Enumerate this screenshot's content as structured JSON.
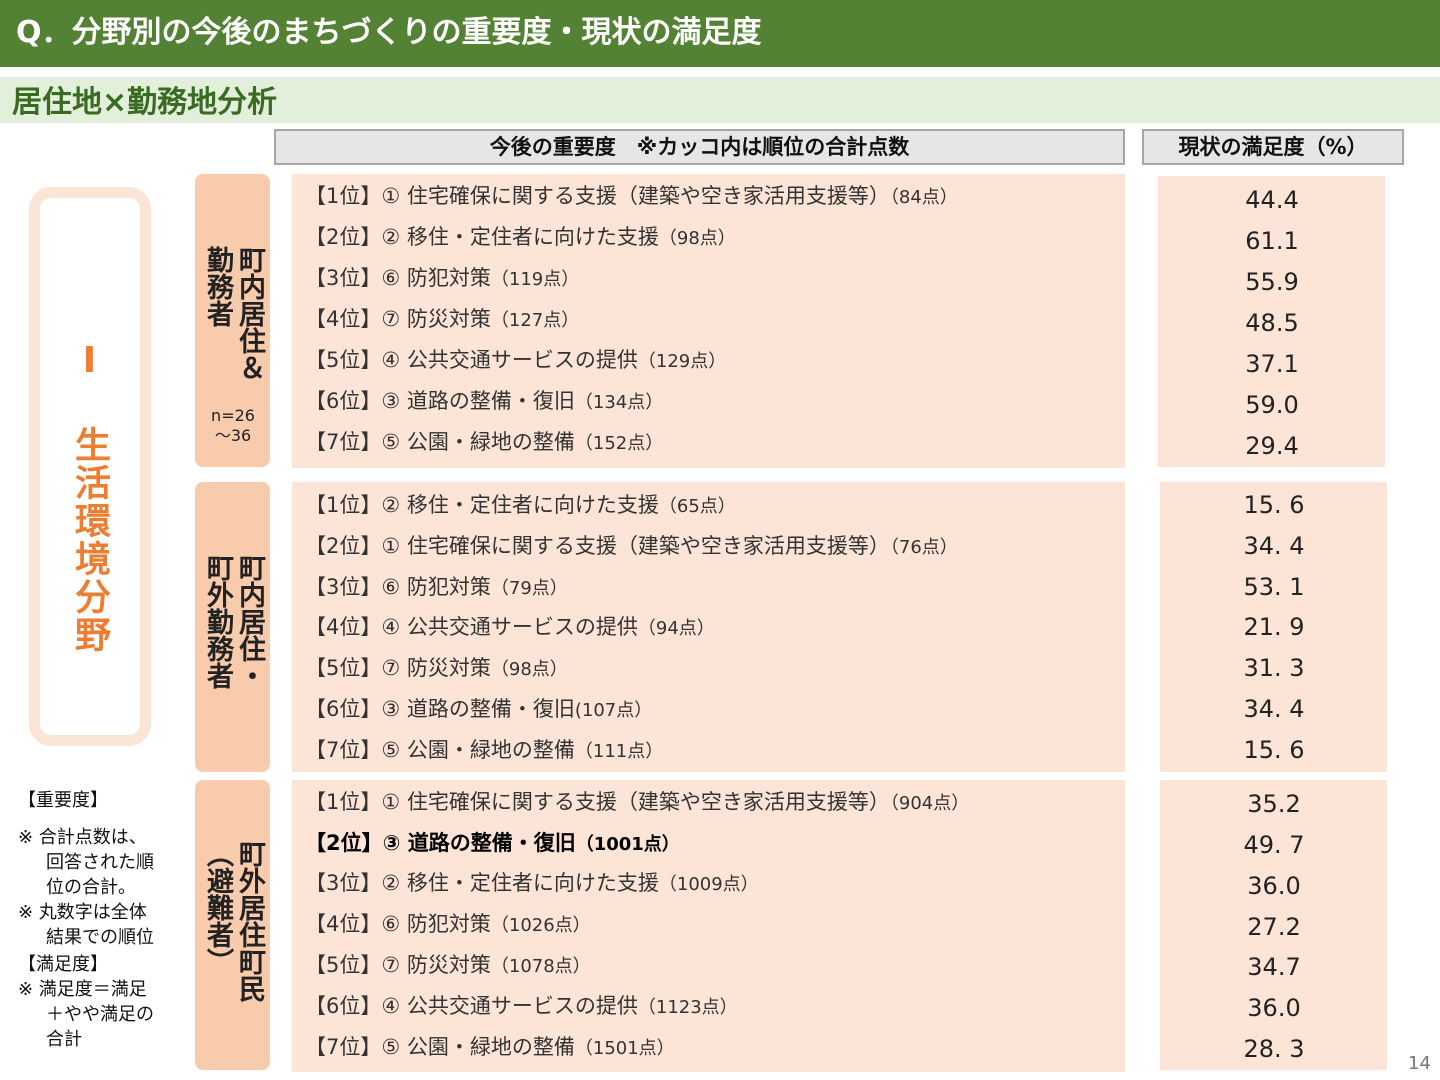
{
  "header": {
    "title": "Q．分野別の今後のまちづくりの重要度・現状の満足度",
    "subtitle": "居住地×勤務地分析"
  },
  "columns": {
    "importance": "今後の重要度　※カッコ内は順位の合計点数",
    "satisfaction": "現状の満足度（%）"
  },
  "category": "Ⅰ 生活環境分野",
  "groups": [
    {
      "title": "町内居住＆\n勤務者",
      "n": "n=26\n～36",
      "rows": [
        {
          "rank": "【1位】① 住宅確保に関する支援（建築や空き家活用支援等）",
          "points": "（84点）",
          "satisfaction": "44.4"
        },
        {
          "rank": "【2位】② 移住・定住者に向けた支援",
          "points": "（98点）",
          "satisfaction": "61.1"
        },
        {
          "rank": "【3位】⑥ 防犯対策",
          "points": "（119点）",
          "satisfaction": "55.9"
        },
        {
          "rank": "【4位】⑦ 防災対策",
          "points": "（127点）",
          "satisfaction": "48.5"
        },
        {
          "rank": "【5位】④ 公共交通サービスの提供",
          "points": "（129点）",
          "satisfaction": "37.1"
        },
        {
          "rank": "【6位】③ 道路の整備・復旧",
          "points": "（134点）",
          "satisfaction": "59.0"
        },
        {
          "rank": "【7位】⑤ 公園・緑地の整備",
          "points": "（152点）",
          "satisfaction": "29.4"
        }
      ]
    },
    {
      "title": "町内居住・\n町外勤務者",
      "n": "",
      "rows": [
        {
          "rank": "【1位】② 移住・定住者に向けた支援",
          "points": "（65点）",
          "satisfaction": "15. 6"
        },
        {
          "rank": "【2位】① 住宅確保に関する支援（建築や空き家活用支援等）",
          "points": "（76点）",
          "satisfaction": "34. 4"
        },
        {
          "rank": "【3位】⑥ 防犯対策",
          "points": "（79点）",
          "satisfaction": "53. 1"
        },
        {
          "rank": "【4位】④ 公共交通サービスの提供",
          "points": "（94点）",
          "satisfaction": "21. 9"
        },
        {
          "rank": "【5位】⑦ 防災対策",
          "points": "（98点）",
          "satisfaction": "31. 3"
        },
        {
          "rank": "【6位】③ 道路の整備・復旧",
          "points": "(107点）",
          "satisfaction": "34. 4"
        },
        {
          "rank": "【7位】⑤ 公園・緑地の整備",
          "points": "（111点）",
          "satisfaction": "15. 6"
        }
      ]
    },
    {
      "title": "町外居住町民\n（避難者）",
      "n": "",
      "rows": [
        {
          "rank": "【1位】① 住宅確保に関する支援（建築や空き家活用支援等）",
          "points": "（904点）",
          "satisfaction": "35.2"
        },
        {
          "rank": "【2位】③ 道路の整備・復旧",
          "points": "（1001点）",
          "satisfaction": "49. 7",
          "bold": true
        },
        {
          "rank": "【3位】② 移住・定住者に向けた支援",
          "points": "（1009点）",
          "satisfaction": "36.0"
        },
        {
          "rank": "【4位】⑥ 防犯対策",
          "points": "（1026点）",
          "satisfaction": "27.2"
        },
        {
          "rank": "【5位】⑦ 防災対策",
          "points": "（1078点）",
          "satisfaction": "34.7"
        },
        {
          "rank": "【6位】④ 公共交通サービスの提供",
          "points": "（1123点）",
          "satisfaction": "36.0"
        },
        {
          "rank": "【7位】⑤ 公園・緑地の整備",
          "points": "（1501点）",
          "satisfaction": "28. 3"
        }
      ]
    }
  ],
  "notes": {
    "importance_heading": "【重要度】",
    "importance_note1_a": "※ 合計点数は、",
    "importance_note1_b": "回答された順",
    "importance_note1_c": "位の合計。",
    "importance_note2_a": "※ 丸数字は全体",
    "importance_note2_b": "結果での順位",
    "satisfaction_heading": "【満足度】",
    "satisfaction_note_a": "※ 満足度＝満足",
    "satisfaction_note_b": "＋やや満足の",
    "satisfaction_note_c": "合計"
  },
  "page_number": "14"
}
